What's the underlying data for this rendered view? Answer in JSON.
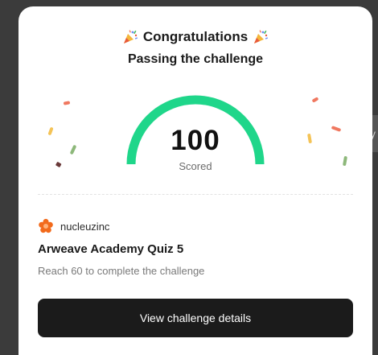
{
  "modal": {
    "title": "Congratulations",
    "subtitle": "Passing the challenge",
    "title_icon": "party-popper-icon"
  },
  "score": {
    "value": "100",
    "label": "Scored",
    "fraction": 1.0,
    "color": "#1fd68a"
  },
  "challenge": {
    "org_name": "nucleuzinc",
    "org_logo_icon": "org-logo-icon",
    "org_logo_color": "#f26a1b",
    "title": "Arweave Academy Quiz 5",
    "description": "Reach 60 to complete the challenge"
  },
  "actions": {
    "view_details_label": "View challenge details"
  },
  "confetti_colors": [
    "#f07860",
    "#f4c356",
    "#8db87a",
    "#6a3a3a"
  ]
}
